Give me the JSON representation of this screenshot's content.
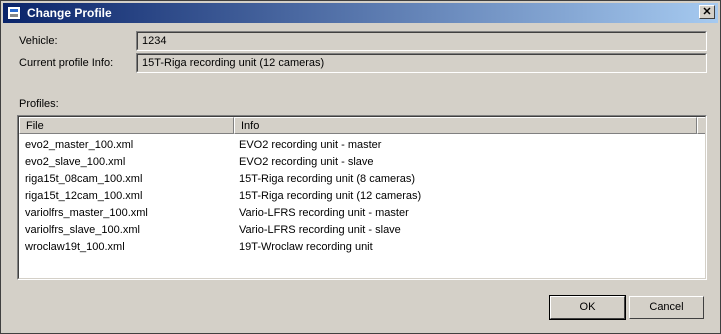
{
  "window": {
    "title": "Change Profile",
    "close_glyph": "✕"
  },
  "vehicle": {
    "label": "Vehicle:",
    "value": "1234"
  },
  "current_profile": {
    "label": "Current profile Info:",
    "value": "15T-Riga recording unit (12 cameras)"
  },
  "profiles": {
    "label": "Profiles:",
    "columns": {
      "file": "File",
      "info": "Info"
    },
    "rows": [
      {
        "file": "evo2_master_100.xml",
        "info": "EVO2 recording unit - master"
      },
      {
        "file": "evo2_slave_100.xml",
        "info": "EVO2 recording unit - slave"
      },
      {
        "file": "riga15t_08cam_100.xml",
        "info": "15T-Riga recording unit (8 cameras)"
      },
      {
        "file": "riga15t_12cam_100.xml",
        "info": "15T-Riga recording unit (12 cameras)"
      },
      {
        "file": "variolfrs_master_100.xml",
        "info": "Vario-LFRS recording unit - master"
      },
      {
        "file": "variolfrs_slave_100.xml",
        "info": "Vario-LFRS recording unit - slave"
      },
      {
        "file": "wroclaw19t_100.xml",
        "info": "19T-Wroclaw recording unit"
      }
    ]
  },
  "buttons": {
    "ok": "OK",
    "cancel": "Cancel"
  }
}
